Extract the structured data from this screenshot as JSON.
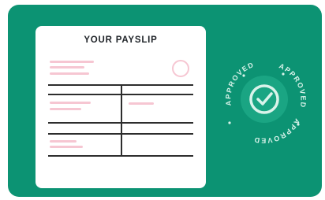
{
  "payslip": {
    "title": "YOUR PAYSLIP"
  },
  "stamp": {
    "top_text": "APPROVED",
    "right_text": "APPROVED",
    "bottom_text": "APPROVED",
    "icon": "check-icon"
  },
  "colors": {
    "card_background": "#0c9373",
    "stamp_inner": "#1aa583",
    "stamp_ring_text": "#d9f3ea",
    "accent_pink": "#f6c6d2",
    "table_lines": "#2d2d2d"
  }
}
